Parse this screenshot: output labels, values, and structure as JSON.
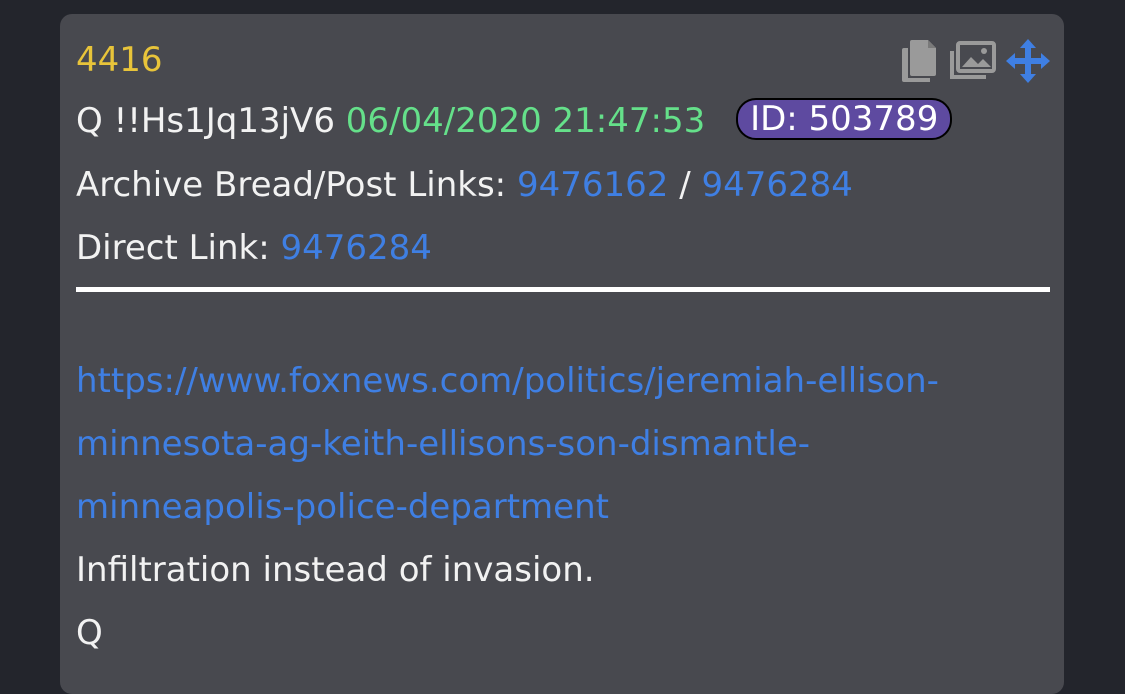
{
  "post": {
    "number": "4416",
    "author": "Q !!Hs1Jq13jV6",
    "timestamp": "06/04/2020 21:47:53",
    "id_badge": "ID: 503789",
    "archive_label": "Archive Bread/Post Links:",
    "archive_bread_link": "9476162",
    "archive_separator": "/",
    "archive_post_link": "9476284",
    "direct_label": "Direct Link:",
    "direct_link": "9476284",
    "url_lines": [
      "https://www.foxnews.com/politics/jeremiah-ellison-",
      "minnesota-ag-keith-ellisons-son-dismantle-",
      "minneapolis-police-department"
    ],
    "message": "Infiltration instead of invasion.",
    "signature": "Q"
  },
  "toolbar": {
    "icons": [
      "copy-icon",
      "image-gallery-icon",
      "move-icon"
    ]
  },
  "colors": {
    "page_bg": "#23252c",
    "card_bg": "#48494f",
    "post_number": "#e8c43a",
    "timestamp": "#65e08a",
    "link": "#3f7fe3",
    "id_badge_bg": "#5e4aa0"
  }
}
